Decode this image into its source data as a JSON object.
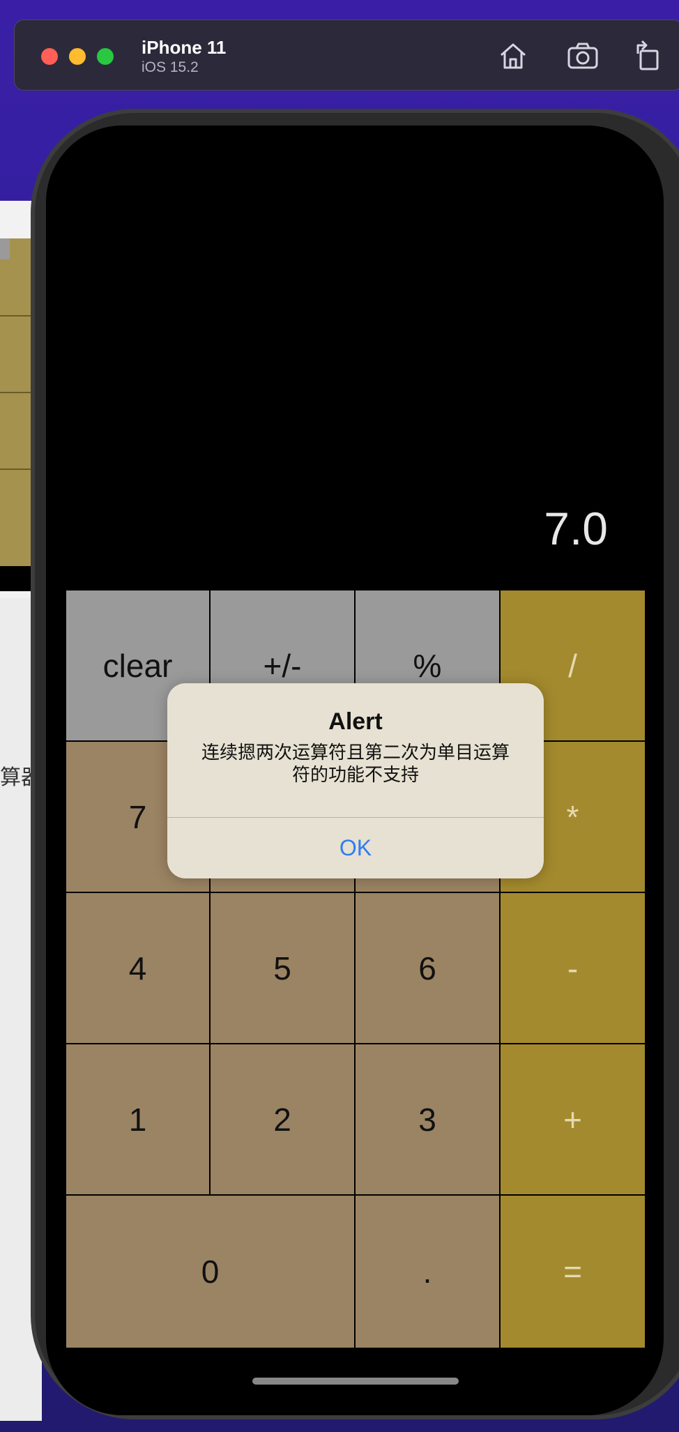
{
  "simulator": {
    "device": "iPhone 11",
    "os": "iOS 15.2"
  },
  "toolbar_icons": [
    "home-icon",
    "screenshot-icon",
    "rotate-icon"
  ],
  "background_window": {
    "text": "算器"
  },
  "calculator": {
    "display": "7.0",
    "keys": {
      "clear": "clear",
      "plusminus": "+/-",
      "percent": "%",
      "divide": "/",
      "seven": "7",
      "multiply": "*",
      "four": "4",
      "five": "5",
      "six": "6",
      "minus": "-",
      "one": "1",
      "two": "2",
      "three": "3",
      "plus": "+",
      "zero": "0",
      "dot": ".",
      "equals": "="
    },
    "colors": {
      "function_key": "#9a9a9a",
      "number_key": "#9b8463",
      "operator_key": "#a48a2e"
    }
  },
  "alert": {
    "title": "Alert",
    "message": "连续摁两次运算符且第二次为单目运算符的功能不支持",
    "ok": "OK"
  }
}
